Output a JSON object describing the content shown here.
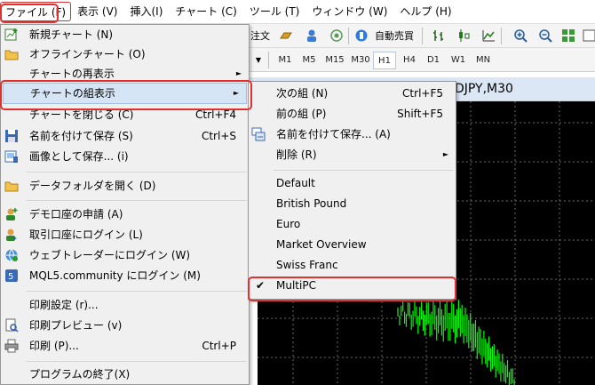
{
  "menubar": {
    "items": [
      "ファイル (F)",
      "表示 (V)",
      "挿入(I)",
      "チャート (C)",
      "ツール (T)",
      "ウィンドウ (W)",
      "ヘルプ (H)"
    ]
  },
  "toolbar": {
    "order_label": "注文",
    "autotrade_label": "自動売買",
    "timeframes": [
      "M1",
      "M5",
      "M15",
      "M30",
      "H1",
      "H4",
      "D1",
      "W1",
      "MN"
    ],
    "selected_timeframe": "H1"
  },
  "chart": {
    "title": "DJPY,M30",
    "background": "#000000",
    "candle_color": "#00ff00"
  },
  "file_menu": {
    "items": [
      {
        "label": "新規チャート (N)",
        "icon": "new-chart-icon"
      },
      {
        "label": "オフラインチャート (O)",
        "icon": "folder-icon"
      },
      {
        "label": "チャートの再表示",
        "submenu": true
      },
      {
        "label": "チャートの組表示",
        "submenu": true,
        "highlighted": true
      },
      {
        "label": "チャートを閉じる (C)",
        "shortcut": "Ctrl+F4"
      },
      {
        "label": "名前を付けて保存 (S)",
        "shortcut": "Ctrl+S",
        "icon": "save-icon"
      },
      {
        "label": "画像として保存... (i)",
        "icon": "save-image-icon"
      },
      {
        "label": "データフォルダを開く (D)",
        "icon": "open-folder-icon"
      },
      {
        "label": "デモ口座の申請 (A)",
        "icon": "demo-account-icon"
      },
      {
        "label": "取引口座にログイン (L)",
        "icon": "login-icon"
      },
      {
        "label": "ウェブトレーダーにログイン (W)",
        "icon": "webtrader-icon"
      },
      {
        "label": "MQL5.community にログイン (M)",
        "icon": "mql5-icon"
      },
      {
        "label": "印刷設定 (r)..."
      },
      {
        "label": "印刷プレビュー (v)",
        "icon": "print-preview-icon"
      },
      {
        "label": "印刷 (P)...",
        "shortcut": "Ctrl+P",
        "icon": "print-icon"
      },
      {
        "label": "プログラムの終了(X)"
      }
    ]
  },
  "sub_menu": {
    "items": [
      {
        "label": "次の組 (N)",
        "shortcut": "Ctrl+F5"
      },
      {
        "label": "前の組 (P)",
        "shortcut": "Shift+F5"
      },
      {
        "label": "名前を付けて保存... (A)",
        "icon": "save-profile-icon"
      },
      {
        "label": "削除 (R)",
        "submenu": true
      },
      {
        "label": "Default"
      },
      {
        "label": "British Pound"
      },
      {
        "label": "Euro"
      },
      {
        "label": "Market Overview"
      },
      {
        "label": "Swiss Franc"
      },
      {
        "label": "MultiPC",
        "checked": true
      }
    ]
  },
  "colors": {
    "highlight": "#d6e5f5",
    "annotation": "#e23030",
    "menu_bg": "#f0f0f0"
  }
}
